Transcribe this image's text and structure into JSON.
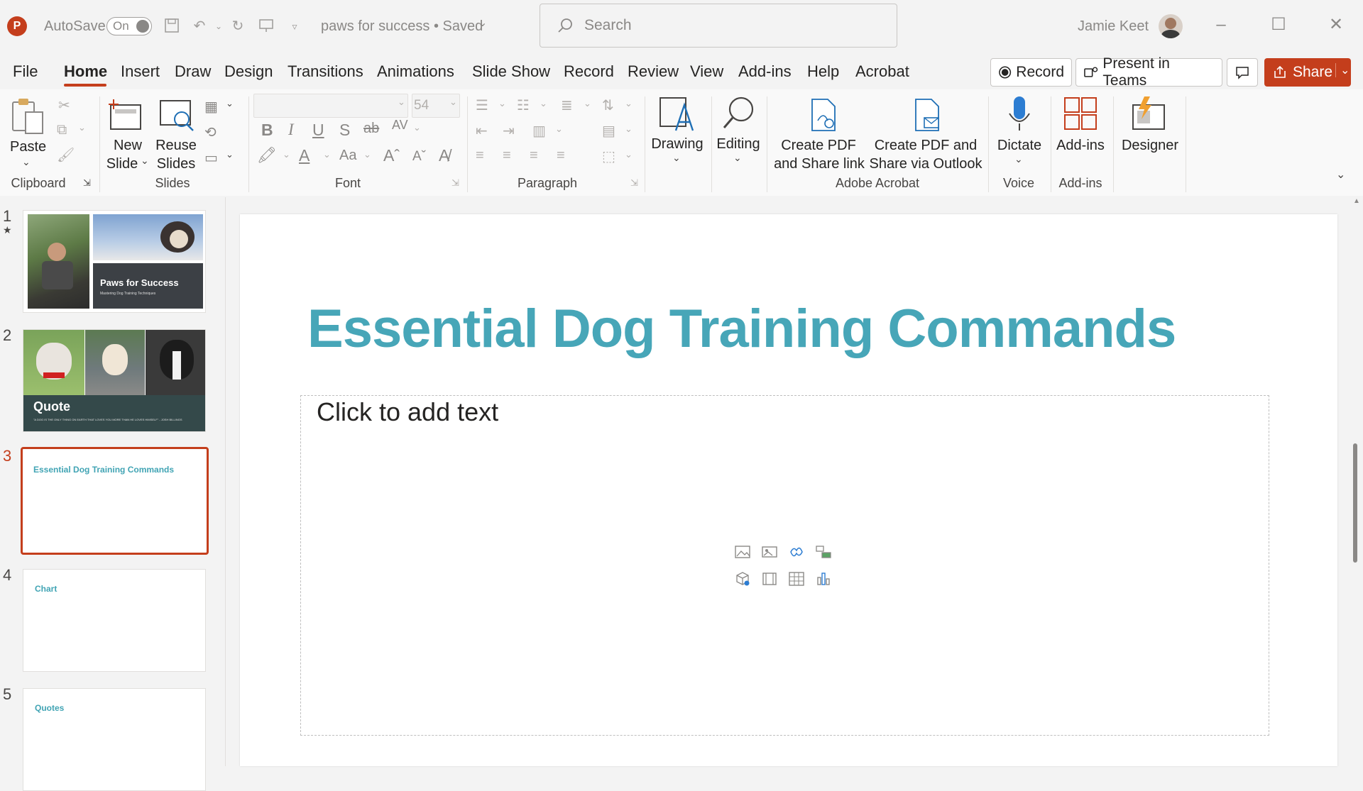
{
  "titlebar": {
    "autosave_label": "AutoSave",
    "autosave_state": "On",
    "doc_title": "paws for success • Saved",
    "search_placeholder": "Search",
    "user_name": "Jamie Keet"
  },
  "tabs": [
    "File",
    "Home",
    "Insert",
    "Draw",
    "Design",
    "Transitions",
    "Animations",
    "Slide Show",
    "Record",
    "Review",
    "View",
    "Add-ins",
    "Help",
    "Acrobat"
  ],
  "header_buttons": {
    "record": "Record",
    "present_teams": "Present in Teams",
    "share": "Share"
  },
  "ribbon": {
    "paste": "Paste",
    "new_slide_1": "New",
    "new_slide_2": "Slide",
    "reuse_1": "Reuse",
    "reuse_2": "Slides",
    "font_size": "54",
    "drawing": "Drawing",
    "editing": "Editing",
    "create_pdf_link_1": "Create PDF",
    "create_pdf_link_2": "and Share link",
    "create_pdf_outlook_1": "Create PDF and",
    "create_pdf_outlook_2": "Share via Outlook",
    "dictate": "Dictate",
    "addins": "Add-ins",
    "designer": "Designer",
    "groups": {
      "clipboard": "Clipboard",
      "slides": "Slides",
      "font": "Font",
      "paragraph": "Paragraph",
      "acrobat": "Adobe Acrobat",
      "voice": "Voice",
      "addins": "Add-ins"
    }
  },
  "thumbnails": [
    {
      "num": "1",
      "title": "Paws for Success",
      "subtitle": "Mastering Dog Training Techniques"
    },
    {
      "num": "2",
      "title": "Quote",
      "subtitle": "\"A DOG IS THE ONLY THING ON EARTH THAT LOVES YOU MORE THAN HE LOVES HIMSELF\" - JOSH BILLINGS"
    },
    {
      "num": "3",
      "title": "Essential Dog Training Commands"
    },
    {
      "num": "4",
      "title": "Chart"
    },
    {
      "num": "5",
      "title": "Quotes"
    }
  ],
  "slide": {
    "title": "Essential Dog Training Commands",
    "content_placeholder": "Click to add text"
  },
  "colors": {
    "accent": "#c43e1c",
    "title_teal": "#47a6b8"
  }
}
